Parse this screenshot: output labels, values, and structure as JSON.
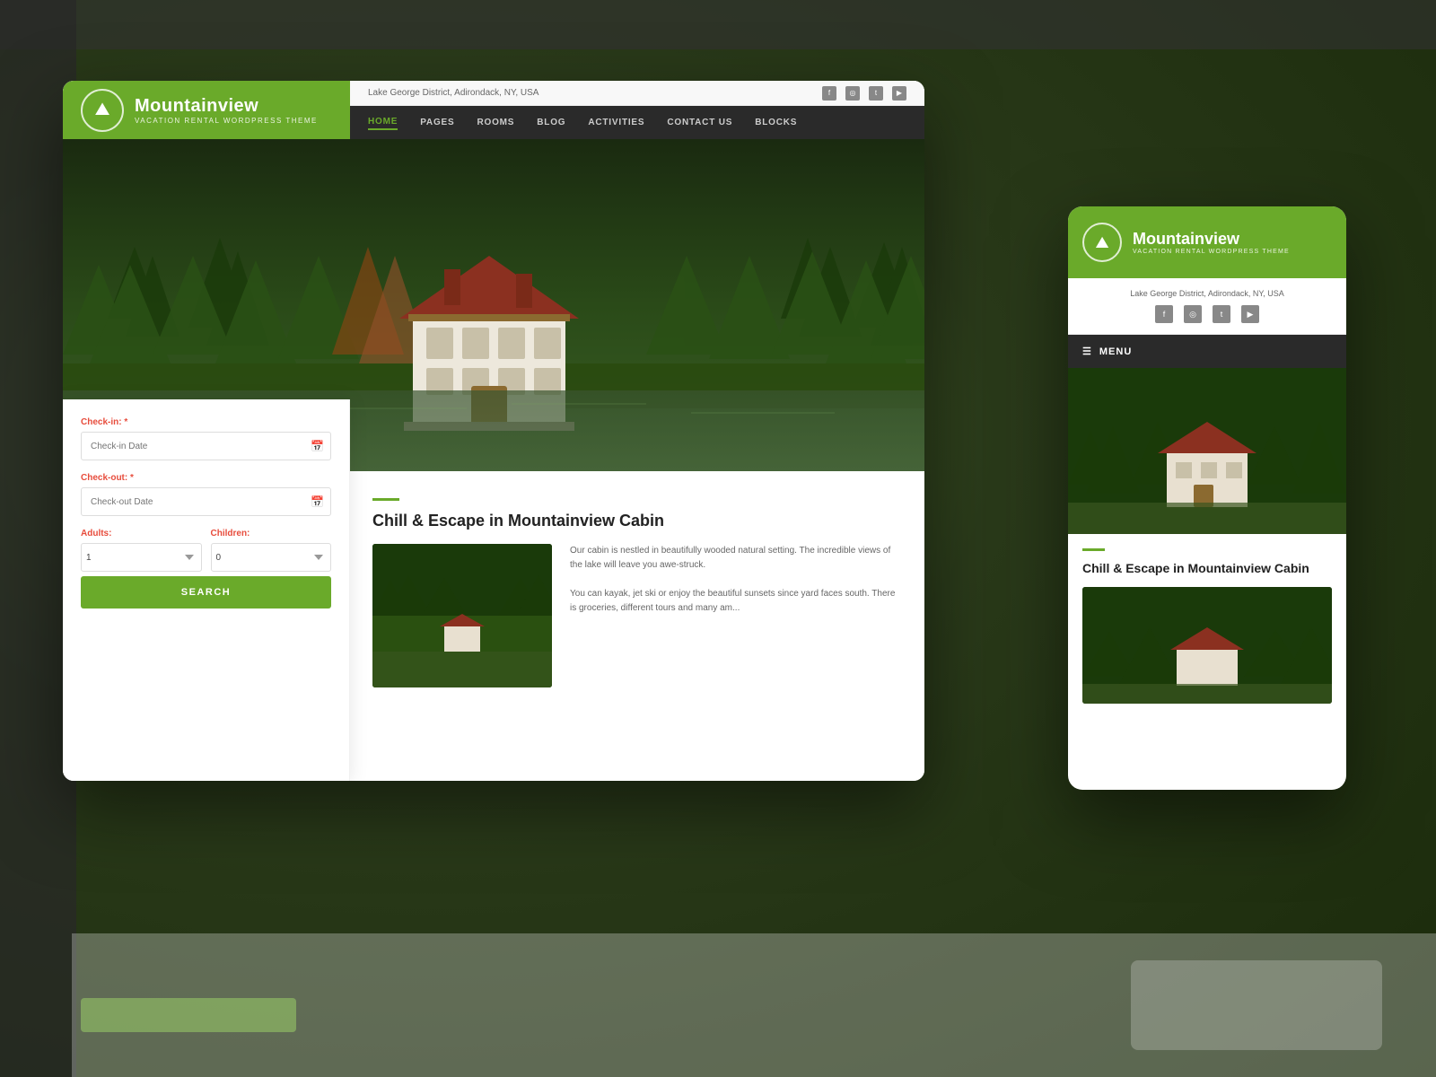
{
  "background": {
    "color": "#4a4a4a"
  },
  "desktop": {
    "logo": {
      "brand": "Mountainview",
      "tagline": "VACATION RENTAL WORDPRESS THEME",
      "icon": "⛰"
    },
    "topbar": {
      "location": "Lake George District, Adirondack, NY, USA",
      "social": [
        "f",
        "in",
        "tw",
        "yt"
      ]
    },
    "nav": {
      "items": [
        {
          "label": "HOME",
          "active": true
        },
        {
          "label": "PAGES",
          "active": false
        },
        {
          "label": "ROOMS",
          "active": false
        },
        {
          "label": "BLOG",
          "active": false
        },
        {
          "label": "ACTIVITIES",
          "active": false
        },
        {
          "label": "CONTACT US",
          "active": false
        },
        {
          "label": "BLOCKS",
          "active": false
        }
      ]
    },
    "booking": {
      "checkin_label": "Check-in:",
      "checkin_placeholder": "Check-in Date",
      "checkout_label": "Check-out:",
      "checkout_placeholder": "Check-out Date",
      "adults_label": "Adults:",
      "adults_value": "1",
      "children_label": "Children:",
      "children_value": "0",
      "search_btn": "SEARCH"
    },
    "content": {
      "title": "Chill & Escape in Mountainview Cabin",
      "text1": "Our cabin is nestled in beautifully wooded natural setting. The incredible views of the lake will leave you awe-struck.",
      "text2": "You can kayak, jet ski or enjoy the beautiful sunsets since yard faces south. There is groceries, different tours and many am..."
    }
  },
  "mobile": {
    "logo": {
      "brand": "Mountainview",
      "tagline": "VACATION RENTAL WORDPRESS THEME",
      "icon": "⛰"
    },
    "topbar": {
      "location": "Lake George District, Adirondack, NY, USA",
      "social": [
        "f",
        "in",
        "tw",
        "yt"
      ]
    },
    "nav": {
      "menu_icon": "☰",
      "menu_label": "MENU"
    },
    "content": {
      "title": "Chill & Escape in Mountainview Cabin"
    }
  }
}
